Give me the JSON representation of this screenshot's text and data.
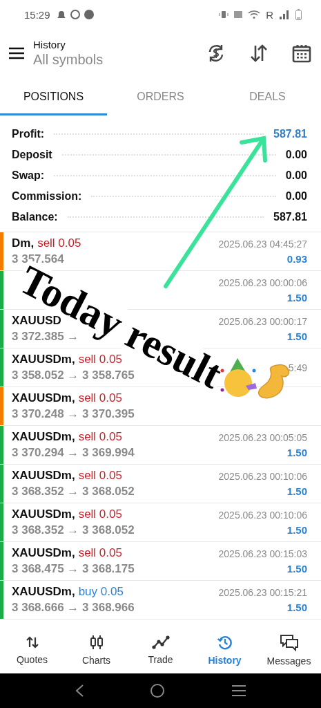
{
  "status_bar": {
    "time": "15:29",
    "network_label": "R"
  },
  "header": {
    "title": "History",
    "subtitle": "All symbols"
  },
  "tabs": [
    {
      "label": "POSITIONS",
      "selected": true
    },
    {
      "label": "ORDERS",
      "selected": false
    },
    {
      "label": "DEALS",
      "selected": false
    }
  ],
  "summary": [
    {
      "label": "Profit:",
      "value": "587.81",
      "highlight": true
    },
    {
      "label": "Deposit",
      "value": "0.00",
      "highlight": false
    },
    {
      "label": "Swap:",
      "value": "0.00",
      "highlight": false
    },
    {
      "label": "Commission:",
      "value": "0.00",
      "highlight": false
    },
    {
      "label": "Balance:",
      "value": "587.81",
      "highlight": false
    }
  ],
  "positions": [
    {
      "color": "#f57c00",
      "symbol": "Dm,",
      "kind": "sell",
      "trade": "sell 0.05",
      "prices": "3 357.564",
      "time": "2025.06.23 04:45:27",
      "profit": "0.93"
    },
    {
      "color": "#1aae45",
      "time": "2025.06.23 00:00:06",
      "profit": "1.50"
    },
    {
      "color": "#1aae45",
      "symbol": "XAUUSD",
      "prices": "3 372.385 →",
      "time": "2025.06.23 00:00:17",
      "profit": "1.50"
    },
    {
      "color": "#1aae45",
      "symbol": "XAUUSDm,",
      "kind": "sell",
      "trade": "sell 0.05",
      "prices": "3 358.052 → 3 358.765",
      "time": "5:49"
    },
    {
      "color": "#f57c00",
      "symbol": "XAUUSDm,",
      "kind": "sell",
      "trade": "sell 0.05",
      "prices": "3 370.248 → 3 370.395"
    },
    {
      "color": "#1aae45",
      "symbol": "XAUUSDm,",
      "kind": "sell",
      "trade": "sell 0.05",
      "prices": "3 370.294 → 3 369.994",
      "time": "2025.06.23 00:05:05",
      "profit": "1.50"
    },
    {
      "color": "#1aae45",
      "symbol": "XAUUSDm,",
      "kind": "sell",
      "trade": "sell 0.05",
      "prices": "3 368.352 → 3 368.052",
      "time": "2025.06.23 00:10:06",
      "profit": "1.50"
    },
    {
      "color": "#1aae45",
      "symbol": "XAUUSDm,",
      "kind": "sell",
      "trade": "sell 0.05",
      "prices": "3 368.352 → 3 368.052",
      "time": "2025.06.23 00:10:06",
      "profit": "1.50"
    },
    {
      "color": "#1aae45",
      "symbol": "XAUUSDm,",
      "kind": "sell",
      "trade": "sell 0.05",
      "prices": "3 368.475 → 3 368.175",
      "time": "2025.06.23 00:15:03",
      "profit": "1.50"
    },
    {
      "color": "#1aae45",
      "symbol": "XAUUSDm,",
      "kind": "buy",
      "trade": "buy 0.05",
      "prices": "3 368.666 → 3 368.966",
      "time": "2025.06.23 00:15:21",
      "profit": "1.50"
    }
  ],
  "bottom_nav": [
    {
      "kind": "quotes",
      "label": "Quotes",
      "selected": false
    },
    {
      "kind": "charts",
      "label": "Charts",
      "selected": false
    },
    {
      "kind": "trade",
      "label": "Trade",
      "selected": false
    },
    {
      "kind": "history",
      "label": "History",
      "selected": true
    },
    {
      "kind": "messages",
      "label": "Messages",
      "selected": false
    }
  ],
  "overlay": {
    "caption": "Today result"
  }
}
